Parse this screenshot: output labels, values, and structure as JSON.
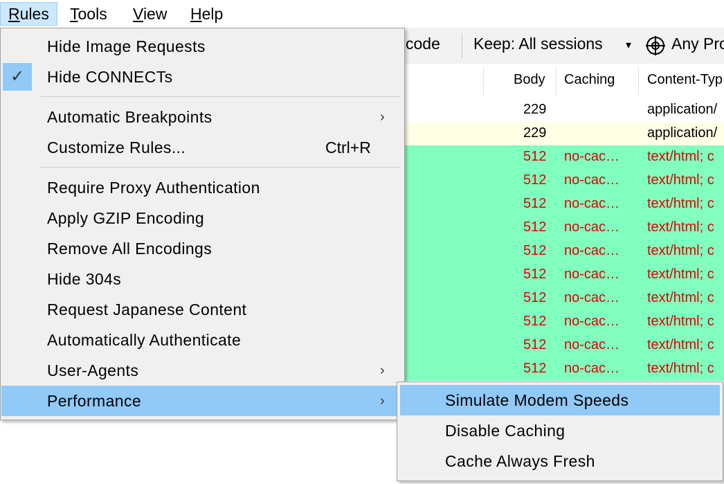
{
  "menubar": {
    "items": [
      {
        "label": "Rules",
        "key": "R",
        "rest": "ules"
      },
      {
        "label": "Tools",
        "key": "T",
        "rest": "ools"
      },
      {
        "label": "View",
        "key": "V",
        "rest": "iew"
      },
      {
        "label": "Help",
        "key": "H",
        "rest": "elp"
      }
    ]
  },
  "toolbar": {
    "decode_partial": "code",
    "keep_label": "Keep: All sessions",
    "keep_arrow": "▾",
    "process_label": "Any Pro"
  },
  "grid": {
    "headers": {
      "body": "Body",
      "caching": "Caching",
      "content_type": "Content-Typ"
    },
    "rows": [
      {
        "style": "plain",
        "body": "229",
        "caching": "",
        "content_type": "application/"
      },
      {
        "style": "yellow",
        "body": "229",
        "caching": "",
        "content_type": "application/"
      },
      {
        "style": "green",
        "body": "512",
        "caching": "no-cac…",
        "content_type": "text/html; c"
      },
      {
        "style": "green",
        "body": "512",
        "caching": "no-cac…",
        "content_type": "text/html; c"
      },
      {
        "style": "green",
        "body": "512",
        "caching": "no-cac…",
        "content_type": "text/html; c"
      },
      {
        "style": "green",
        "body": "512",
        "caching": "no-cac…",
        "content_type": "text/html; c"
      },
      {
        "style": "green",
        "body": "512",
        "caching": "no-cac…",
        "content_type": "text/html; c"
      },
      {
        "style": "green",
        "body": "512",
        "caching": "no-cac…",
        "content_type": "text/html; c"
      },
      {
        "style": "green",
        "body": "512",
        "caching": "no-cac…",
        "content_type": "text/html; c"
      },
      {
        "style": "green",
        "body": "512",
        "caching": "no-cac…",
        "content_type": "text/html; c"
      },
      {
        "style": "green",
        "body": "512",
        "caching": "no-cac…",
        "content_type": "text/html; c"
      },
      {
        "style": "green",
        "body": "512",
        "caching": "no-cac…",
        "content_type": "text/html; c"
      }
    ]
  },
  "rules_menu": {
    "items": {
      "hide_image_requests": "Hide Image Requests",
      "hide_connects": "Hide CONNECTs",
      "automatic_breakpoints": "Automatic Breakpoints",
      "customize_rules": "Customize Rules...",
      "customize_rules_shortcut": "Ctrl+R",
      "require_proxy_auth": "Require Proxy Authentication",
      "apply_gzip": "Apply GZIP Encoding",
      "remove_encodings": "Remove All Encodings",
      "hide_304s": "Hide 304s",
      "request_japanese": "Request Japanese Content",
      "auto_authenticate": "Automatically Authenticate",
      "user_agents": "User-Agents",
      "performance": "Performance"
    },
    "checked": [
      "hide_connects"
    ],
    "highlighted": "performance",
    "check_glyph": "✓",
    "submenu_arrow": "›"
  },
  "performance_submenu": {
    "items": [
      {
        "label": "Simulate Modem Speeds",
        "highlighted": true
      },
      {
        "label": "Disable Caching",
        "highlighted": false
      },
      {
        "label": "Cache Always Fresh",
        "highlighted": false
      }
    ]
  },
  "colors": {
    "menu_bg": "#f0f0f0",
    "highlight": "#91c9f7",
    "green_row": "#80ffbf",
    "yellow_row": "#ffffe6",
    "error_text": "#e00000"
  }
}
